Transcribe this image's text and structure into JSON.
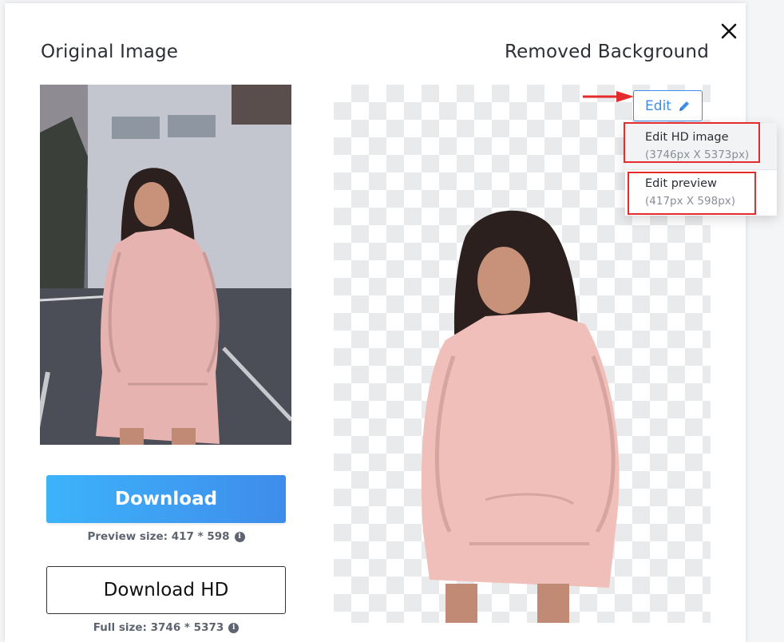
{
  "dialog": {
    "close_icon": "close-icon",
    "left_title": "Original Image",
    "right_title": "Removed Background"
  },
  "buttons": {
    "download_label": "Download",
    "download_hd_label": "Download HD"
  },
  "notes": {
    "preview_size": "Preview size: 417 * 598",
    "full_size": "Full size: 3746 * 5373",
    "info_icon": "info-icon"
  },
  "edit": {
    "label": "Edit",
    "icon": "pencil-icon",
    "menu": [
      {
        "title": "Edit HD image",
        "subtitle": "(3746px X 5373px)"
      },
      {
        "title": "Edit preview",
        "subtitle": "(417px X 598px)"
      }
    ]
  },
  "colors": {
    "accent": "#3d8ee8",
    "download_gradient_start": "#3db3fb",
    "download_gradient_end": "#3e8cea",
    "annotation": "#e52b2b"
  }
}
